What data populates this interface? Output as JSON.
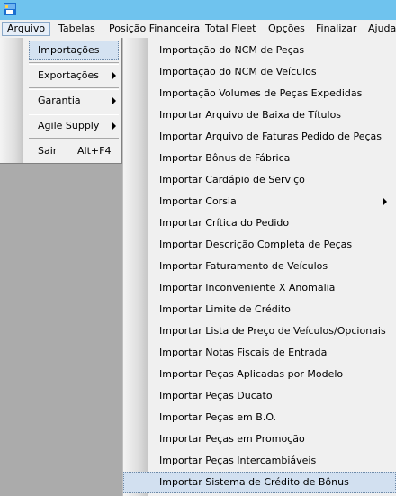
{
  "colors": {
    "titlebar": "#6fc3ee",
    "menu_bg": "#f0f0f0",
    "workspace_bg": "#ababab",
    "highlight": "#d4e2f1"
  },
  "app": {
    "icon": "app-icon"
  },
  "menubar": {
    "items": [
      {
        "label": "Arquivo"
      },
      {
        "label": "Tabelas"
      },
      {
        "label": "Posição Financeira"
      },
      {
        "label": "Total Fleet"
      },
      {
        "label": "Opções"
      },
      {
        "label": "Finalizar"
      },
      {
        "label": "Ajuda"
      }
    ]
  },
  "arquivo_menu": {
    "items": [
      {
        "label": "Importações",
        "shortcut": "",
        "submenu": true
      },
      {
        "label": "Exportações",
        "shortcut": "",
        "submenu": true
      },
      {
        "label": "Garantia",
        "shortcut": "",
        "submenu": true
      },
      {
        "label": "Agile Supply",
        "shortcut": "",
        "submenu": true
      },
      {
        "label": "Sair",
        "shortcut": "Alt+F4",
        "submenu": false
      }
    ]
  },
  "importacoes_menu": {
    "items": [
      {
        "label": "Importação do NCM de Peças"
      },
      {
        "label": "Importação do NCM de Veículos"
      },
      {
        "label": "Importação Volumes de Peças Expedidas"
      },
      {
        "label": "Importar Arquivo de Baixa de Títulos"
      },
      {
        "label": "Importar Arquivo de Faturas Pedido de Peças"
      },
      {
        "label": "Importar Bônus de Fábrica"
      },
      {
        "label": "Importar Cardápio de Serviço"
      },
      {
        "label": "Importar Corsia"
      },
      {
        "label": "Importar Crítica do Pedido"
      },
      {
        "label": "Importar Descrição Completa de Peças"
      },
      {
        "label": "Importar Faturamento de Veículos"
      },
      {
        "label": "Importar Inconveniente X Anomalia"
      },
      {
        "label": "Importar Limite de Crédito"
      },
      {
        "label": "Importar Lista de Preço de Veículos/Opcionais"
      },
      {
        "label": "Importar Notas Fiscais de Entrada"
      },
      {
        "label": "Importar Peças Aplicadas por Modelo"
      },
      {
        "label": "Importar Peças Ducato"
      },
      {
        "label": "Importar Peças em B.O."
      },
      {
        "label": "Importar Peças em Promoção"
      },
      {
        "label": "Importar Peças Intercambiáveis"
      },
      {
        "label": "Importar Sistema de Crédito de Bônus"
      }
    ]
  }
}
